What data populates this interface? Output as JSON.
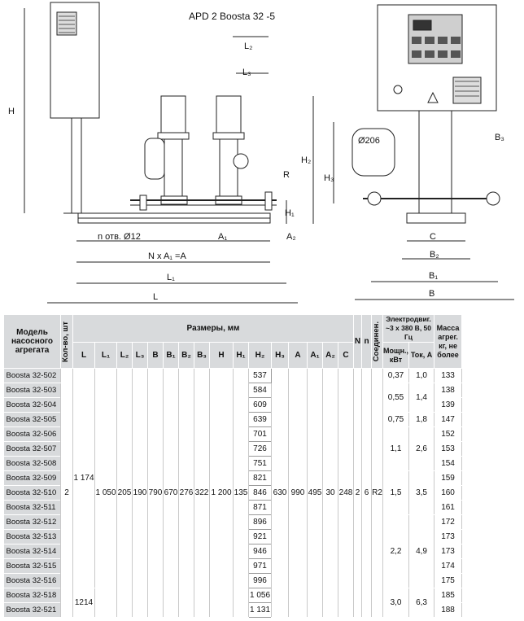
{
  "drawing": {
    "title": "APD  2 Boosta 32 -5",
    "labels": {
      "H": "H",
      "L2": "L₂",
      "L3": "L₃",
      "R": "R",
      "H2": "H₂",
      "H1": "H₁",
      "holes": "n отв. Ø12",
      "A1": "A₁",
      "A2": "A₂",
      "NxA": "N x A₁ =A",
      "L1": "L₁",
      "L": "L",
      "d206": "Ø206",
      "B3": "B₃",
      "H3": "H₃",
      "C": "C",
      "B2": "B₂",
      "B1": "B₁",
      "B": "B"
    }
  },
  "table": {
    "headers": {
      "model": "Модель насосного агрегата",
      "qty": "Кол-во, шт",
      "dims": "Размеры, мм",
      "N": "N",
      "n": "n",
      "conn": "Соединен.",
      "motor": "Электродвиг. ~3 x 380 В, 50 Гц",
      "power": "Мощн., кВт",
      "current": "Ток, А",
      "mass": "Масса агрег. кг, не более"
    },
    "dim_columns": [
      "L",
      "L₁",
      "L₂",
      "L₃",
      "B",
      "B₁",
      "B₂",
      "B₃",
      "H",
      "H₁",
      "H₂",
      "H₃",
      "A",
      "A₁",
      "A₂",
      "C"
    ],
    "common": {
      "qty": "2",
      "L_main": "1 174",
      "L_big": "1214",
      "L1": "1 050",
      "L2": "205",
      "L3": "190",
      "B": "790",
      "B1": "670",
      "B2": "276",
      "B3": "322",
      "H": "1 200",
      "H1": "135",
      "H3": "630",
      "A": "990",
      "A1": "495",
      "A2": "30",
      "C": "248",
      "N": "2",
      "n": "6",
      "conn": "R2"
    },
    "models": [
      "Boosta 32-502",
      "Boosta 32-503",
      "Boosta 32-504",
      "Boosta 32-505",
      "Boosta 32-506",
      "Boosta 32-507",
      "Boosta 32-508",
      "Boosta 32-509",
      "Boosta 32-510",
      "Boosta 32-511",
      "Boosta 32-512",
      "Boosta 32-513",
      "Boosta 32-514",
      "Boosta 32-515",
      "Boosta 32-516",
      "Boosta 32-518",
      "Boosta 32-521"
    ],
    "h2": [
      "537",
      "584",
      "609",
      "639",
      "701",
      "726",
      "751",
      "821",
      "846",
      "871",
      "896",
      "921",
      "946",
      "971",
      "996",
      "1 056",
      "1 131"
    ],
    "mass": [
      "133",
      "138",
      "139",
      "147",
      "152",
      "153",
      "154",
      "159",
      "160",
      "161",
      "172",
      "173",
      "173",
      "174",
      "175",
      "185",
      "188"
    ],
    "power_groups": [
      "0,37",
      "0,55",
      "0,75",
      "1,1",
      "1,5",
      "2,2",
      "3,0"
    ],
    "current_groups": [
      "1,0",
      "1,4",
      "1,8",
      "2,6",
      "3,5",
      "4,9",
      "6,3"
    ]
  }
}
